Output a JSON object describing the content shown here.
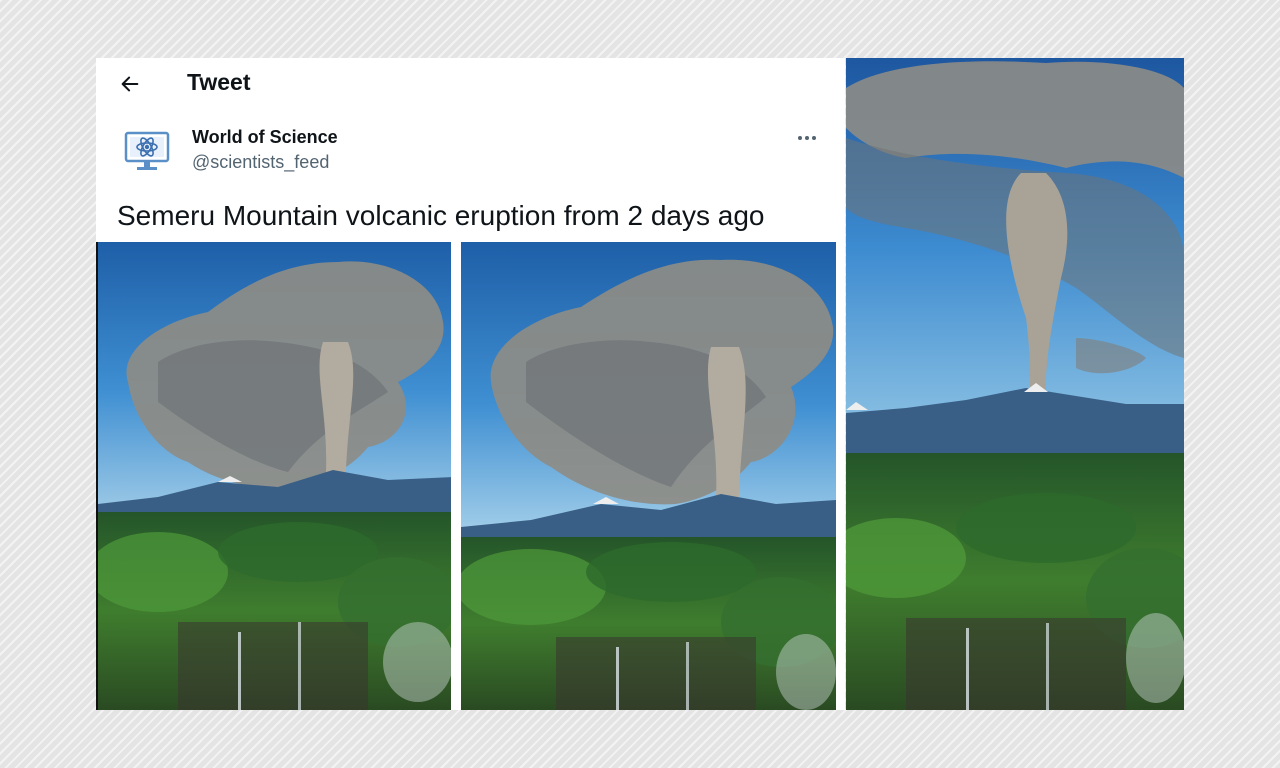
{
  "header": {
    "back_icon": "arrow-left-icon",
    "title": "Tweet"
  },
  "author": {
    "avatar_icon": "atom-monitor-icon",
    "name": "World of Science",
    "handle": "@scientists_feed",
    "more_icon": "more-horizontal-icon"
  },
  "tweet": {
    "text": "Semeru Mountain volcanic eruption from 2 days ago"
  },
  "colors": {
    "sky_top": "#1e5fa8",
    "sky_bottom": "#4a9ad8",
    "plume": "#8a8a84",
    "forest": "#2f6b2a",
    "text_primary": "#0f1419",
    "text_secondary": "#536471"
  }
}
